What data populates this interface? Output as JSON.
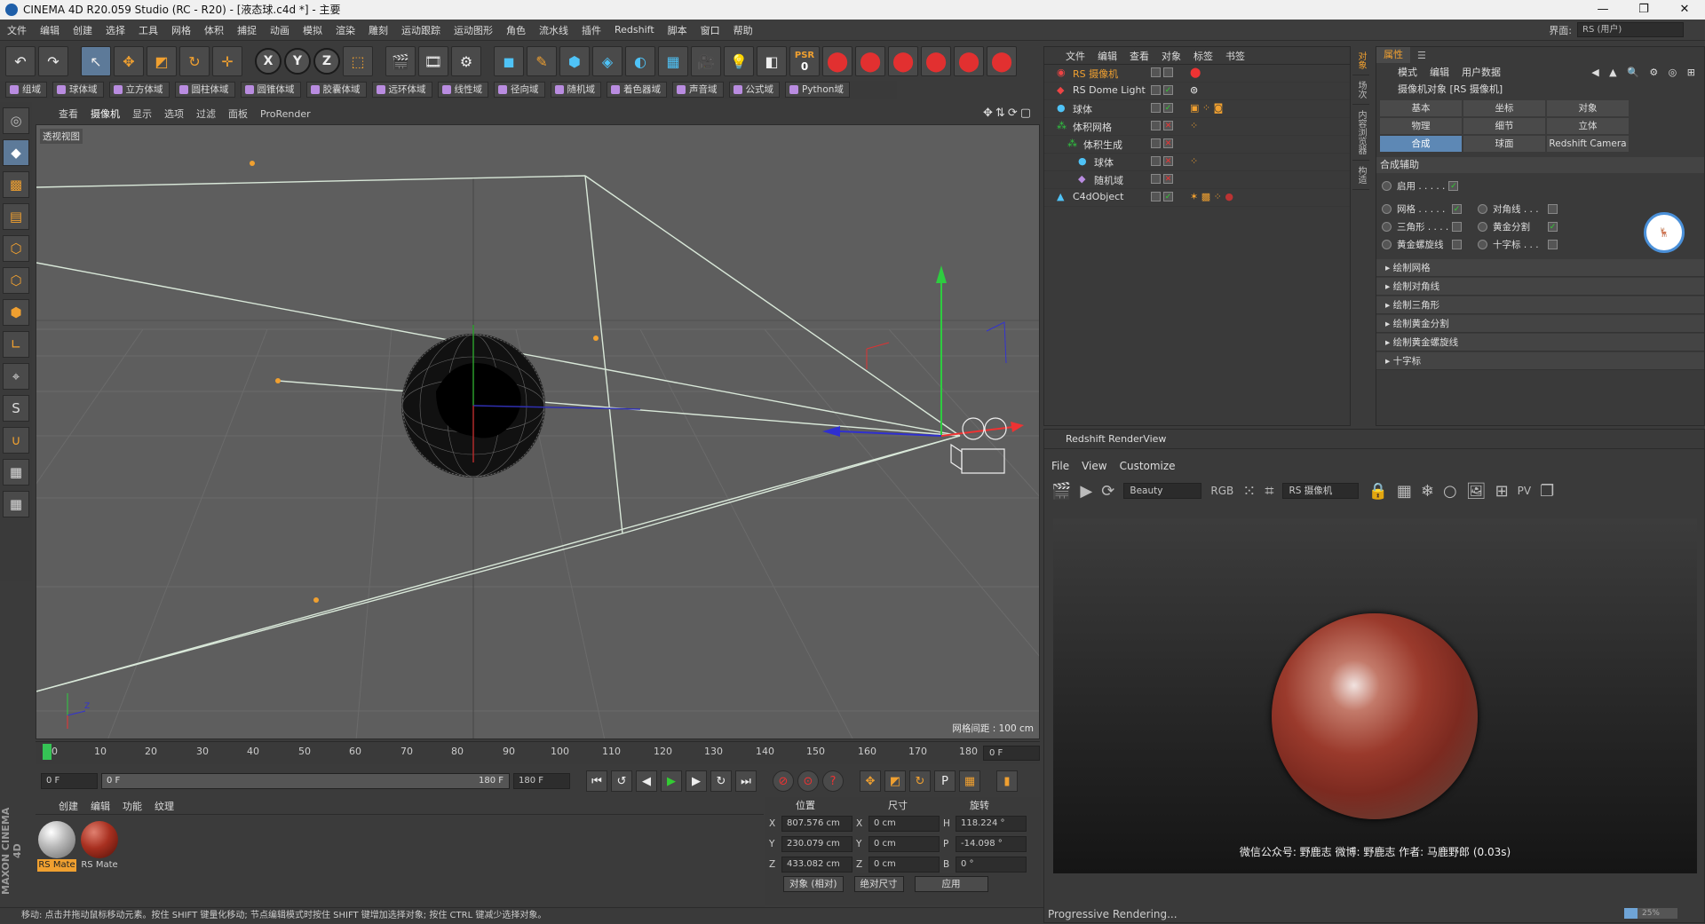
{
  "window": {
    "title": "CINEMA 4D R20.059 Studio (RC - R20) - [液态球.c4d *] - 主要",
    "min": "—",
    "max": "❐",
    "close": "✕"
  },
  "menu": [
    "文件",
    "编辑",
    "创建",
    "选择",
    "工具",
    "网格",
    "体积",
    "捕捉",
    "动画",
    "模拟",
    "渲染",
    "雕刻",
    "运动跟踪",
    "运动图形",
    "角色",
    "流水线",
    "插件",
    "Redshift",
    "脚本",
    "窗口",
    "帮助"
  ],
  "interface": {
    "label": "界面:",
    "value": "RS (用户)"
  },
  "toolbar_psr": {
    "top": "PSR",
    "bottom": "0"
  },
  "modes": [
    "组域",
    "球体域",
    "立方体域",
    "圆柱体域",
    "圆锥体域",
    "胶囊体域",
    "远环体域",
    "线性域",
    "径向域",
    "随机域",
    "着色器域",
    "声音域",
    "公式域",
    "Python域"
  ],
  "viewport": {
    "menu": [
      "查看",
      "摄像机",
      "显示",
      "选项",
      "过滤",
      "面板",
      "ProRender"
    ],
    "label": "透视视图",
    "grid": "网格间距 : 100 cm"
  },
  "timeline": {
    "ticks": [
      "0",
      "10",
      "20",
      "30",
      "40",
      "50",
      "60",
      "70",
      "80",
      "90",
      "100",
      "110",
      "120",
      "130",
      "140",
      "150",
      "160",
      "170",
      "180"
    ],
    "current": "0 F"
  },
  "transport": {
    "start": "0 F",
    "range_start": "0 F",
    "range_end": "180 F",
    "end": "180 F"
  },
  "material_menu": [
    "创建",
    "编辑",
    "功能",
    "纹理"
  ],
  "materials": [
    {
      "label": "RS Mate"
    },
    {
      "label": "RS Mate"
    }
  ],
  "coords": {
    "headers": [
      "位置",
      "尺寸",
      "旋转"
    ],
    "rows": [
      {
        "a1": "X",
        "v1": "807.576 cm",
        "a2": "X",
        "v2": "0 cm",
        "a3": "H",
        "v3": "118.224 °"
      },
      {
        "a1": "Y",
        "v1": "230.079 cm",
        "a2": "Y",
        "v2": "0 cm",
        "a3": "P",
        "v3": "-14.098 °"
      },
      {
        "a1": "Z",
        "v1": "433.082 cm",
        "a2": "Z",
        "v2": "0 cm",
        "a3": "B",
        "v3": "0 °"
      }
    ],
    "mode": "对象 (相对)",
    "size_mode": "绝对尺寸",
    "apply": "应用"
  },
  "status": "移动: 点击并拖动鼠标移动元素。按住 SHIFT 键量化移动; 节点编辑模式时按住 SHIFT 键增加选择对象; 按住 CTRL 键减少选择对象。",
  "brand": "MAXON CINEMA 4D",
  "objects": {
    "menu": [
      "文件",
      "编辑",
      "查看",
      "对象",
      "标签",
      "书签"
    ],
    "rows": [
      {
        "name": "RS 摄像机",
        "indent": 0
      },
      {
        "name": "RS Dome Light",
        "indent": 0
      },
      {
        "name": "球体",
        "indent": 0
      },
      {
        "name": "体积网格",
        "indent": 0
      },
      {
        "name": "体积生成",
        "indent": 1
      },
      {
        "name": "球体",
        "indent": 2
      },
      {
        "name": "随机域",
        "indent": 2
      },
      {
        "name": "C4dObject",
        "indent": 0
      }
    ]
  },
  "side_tabs": [
    "对象",
    "场次",
    "内容浏览器",
    "构造"
  ],
  "attributes": {
    "tab": "属性",
    "menu": [
      "模式",
      "编辑",
      "用户数据"
    ],
    "title": "摄像机对象 [RS 摄像机]",
    "tabs": [
      "基本",
      "坐标",
      "对象",
      "物理",
      "细节",
      "立体",
      "合成",
      "球面",
      "Redshift Camera"
    ],
    "section": "合成辅助",
    "enable": "启用 . . . . .",
    "options": [
      [
        "网格 . . . . .",
        "对角线 . . ."
      ],
      [
        "三角形 . . . .",
        "黄金分割"
      ],
      [
        "黄金螺旋线",
        "十字标 . . ."
      ]
    ],
    "collapsibles": [
      "绘制网格",
      "绘制对角线",
      "绘制三角形",
      "绘制黄金分割",
      "绘制黄金螺旋线",
      "十字标"
    ]
  },
  "renderview": {
    "title": "Redshift RenderView",
    "menu": [
      "File",
      "View",
      "Customize"
    ],
    "aov": "Beauty",
    "camera": "RS 摄像机",
    "credit": "微信公众号: 野鹿志   微博: 野鹿志   作者: 马鹿野郎  (0.03s)",
    "status": "Progressive Rendering...",
    "progress_label": "25%",
    "progress": 0.25
  }
}
